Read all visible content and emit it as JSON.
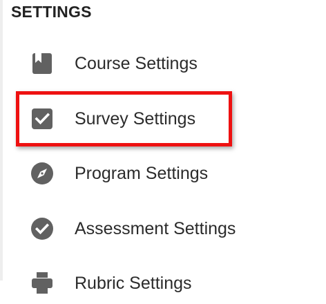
{
  "section": {
    "title": "SETTINGS"
  },
  "menu": {
    "items": [
      {
        "label": "Course Settings",
        "icon": "book-icon"
      },
      {
        "label": "Survey Settings",
        "icon": "checkbox-icon",
        "highlighted": true
      },
      {
        "label": "Program Settings",
        "icon": "compass-icon"
      },
      {
        "label": "Assessment Settings",
        "icon": "check-circle-icon"
      },
      {
        "label": "Rubric Settings",
        "icon": "printer-icon"
      }
    ]
  },
  "colors": {
    "icon": "#616161",
    "text": "#2b2b2b",
    "highlight_border": "#ee1111"
  }
}
